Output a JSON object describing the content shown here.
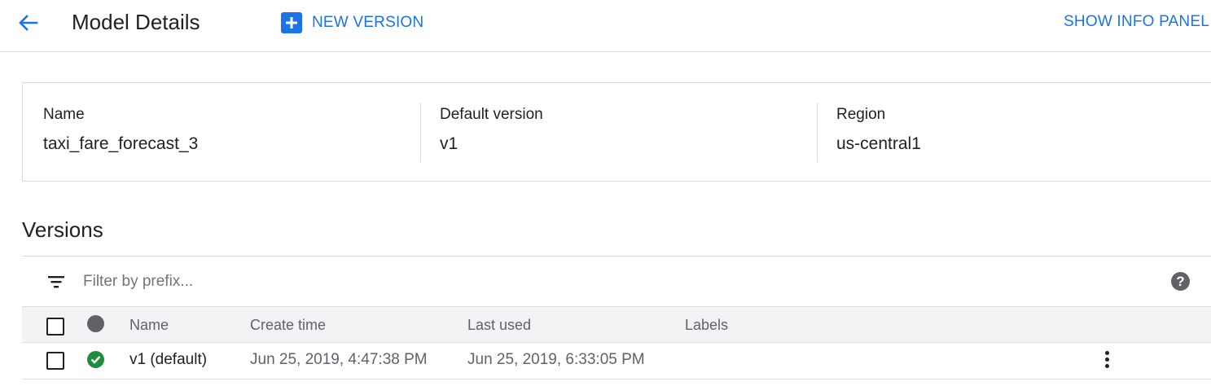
{
  "header": {
    "title": "Model Details",
    "new_version_label": "NEW VERSION",
    "info_panel_label": "SHOW INFO PANEL"
  },
  "summary": {
    "name_label": "Name",
    "name_value": "taxi_fare_forecast_3",
    "default_version_label": "Default version",
    "default_version_value": "v1",
    "region_label": "Region",
    "region_value": "us-central1"
  },
  "versions": {
    "heading": "Versions",
    "filter_placeholder": "Filter by prefix...",
    "help_label": "?",
    "columns": {
      "name": "Name",
      "create_time": "Create time",
      "last_used": "Last used",
      "labels": "Labels"
    },
    "rows": [
      {
        "name": "v1 (default)",
        "create_time": "Jun 25, 2019, 4:47:38 PM",
        "last_used": "Jun 25, 2019, 6:33:05 PM",
        "labels": "",
        "status": "ok"
      }
    ]
  },
  "colors": {
    "accent": "#1a73e8",
    "status_ok": "#1e8e3e",
    "icon_gray": "#5f6368"
  }
}
